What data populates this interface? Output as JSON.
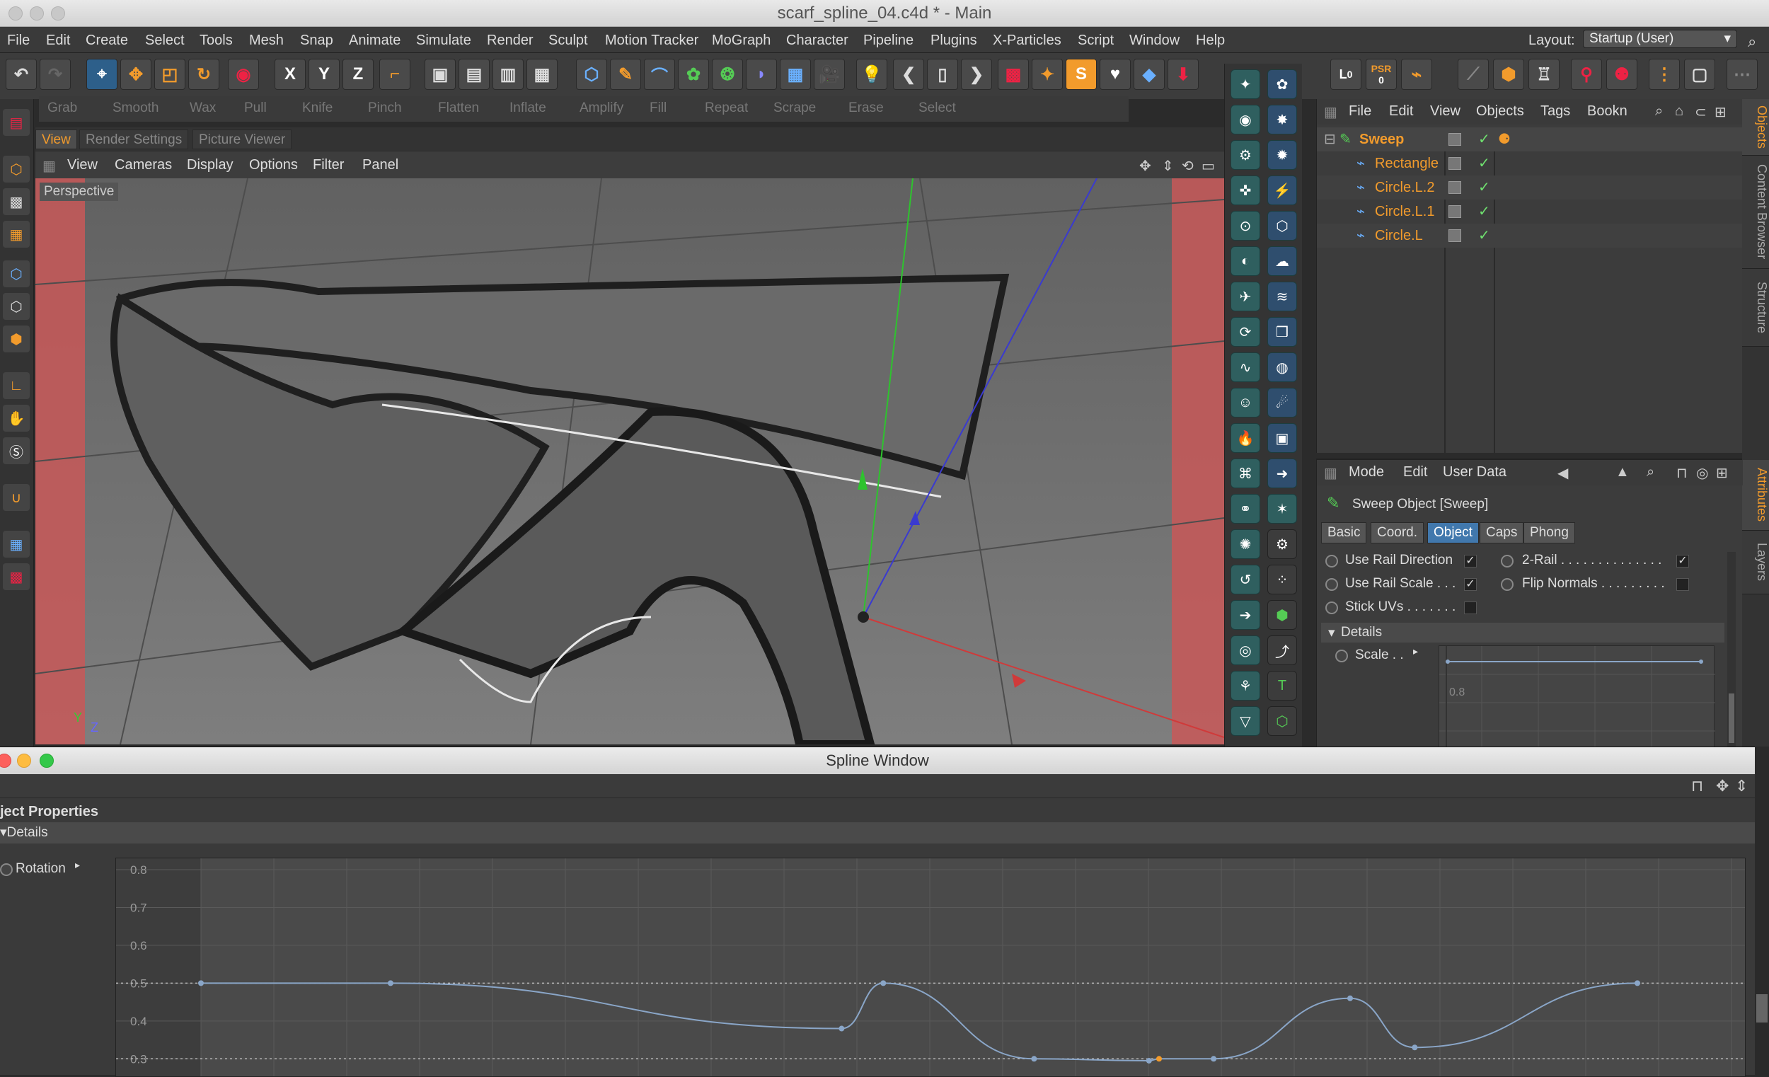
{
  "window": {
    "title": "scarf_spline_04.c4d * - Main"
  },
  "menu": [
    "File",
    "Edit",
    "Create",
    "Select",
    "Tools",
    "Mesh",
    "Snap",
    "Animate",
    "Simulate",
    "Render",
    "Sculpt",
    "Motion Tracker",
    "MoGraph",
    "Character",
    "Pipeline",
    "Plugins",
    "X-Particles",
    "Script",
    "Window",
    "Help"
  ],
  "layout": {
    "label": "Layout:",
    "value": "Startup (User)"
  },
  "toolbar": {
    "axis_x": "X",
    "axis_y": "Y",
    "axis_z": "Z",
    "psr": "PSR",
    "psr_val": "0",
    "lock_val": "0"
  },
  "sculpt": [
    "Grab",
    "Smooth",
    "Wax",
    "Pull",
    "Knife",
    "Pinch",
    "Flatten",
    "Inflate",
    "Amplify",
    "Fill",
    "Repeat",
    "Scrape",
    "Erase",
    "Select"
  ],
  "viewtabs": [
    "View",
    "Render Settings",
    "Picture Viewer"
  ],
  "viewmenu": [
    "View",
    "Cameras",
    "Display",
    "Options",
    "Filter",
    "Panel"
  ],
  "viewport": {
    "label": "Perspective",
    "axis_y": "Y",
    "axis_z": "Z"
  },
  "objects": {
    "menu": [
      "File",
      "Edit",
      "View",
      "Objects",
      "Tags",
      "Bookn"
    ],
    "tree": [
      {
        "name": "Sweep",
        "root": true
      },
      {
        "name": "Rectangle"
      },
      {
        "name": "Circle.L.2"
      },
      {
        "name": "Circle.L.1"
      },
      {
        "name": "Circle.L"
      }
    ],
    "check": "✓"
  },
  "sidetabs": [
    "Objects",
    "Content Browser",
    "Structure",
    "Attributes",
    "Layers"
  ],
  "attributes": {
    "menu": [
      "Mode",
      "Edit",
      "User Data"
    ],
    "heading": "Sweep Object [Sweep]",
    "tabs": [
      "Basic",
      "Coord.",
      "Object",
      "Caps",
      "Phong"
    ],
    "props": {
      "use_rail_direction": "Use Rail Direction",
      "use_rail_scale": "Use Rail Scale . . .",
      "stick_uvs": "Stick UVs . . . . . . .",
      "two_rail": "2-Rail . . . . . . . . . . . . . .",
      "flip_normals": "Flip Normals . . . . . . . . .",
      "details": "Details",
      "scale": "Scale . .",
      "scale_tick": "0.8"
    }
  },
  "spline_window": {
    "title": "Spline Window",
    "props_label": "ject Properties",
    "details_label": "Details",
    "rotation_label": "Rotation"
  },
  "chart_data": {
    "type": "line",
    "title": "",
    "xlabel": "",
    "ylabel": "",
    "yticks": [
      "0.8",
      "0.7",
      "0.6",
      "0.5",
      "0.4",
      "0.3"
    ],
    "ylim": [
      0.25,
      0.83
    ],
    "xlim": [
      0,
      1
    ],
    "grid": true,
    "series": [
      {
        "x": [
          0.0,
          0.132,
          0.446,
          0.475,
          0.58,
          0.66,
          0.667,
          0.705,
          0.8,
          0.845,
          1.0
        ],
        "y": [
          0.5,
          0.5,
          0.38,
          0.5,
          0.3,
          0.295,
          0.3,
          0.3,
          0.46,
          0.33,
          0.5
        ]
      }
    ]
  }
}
